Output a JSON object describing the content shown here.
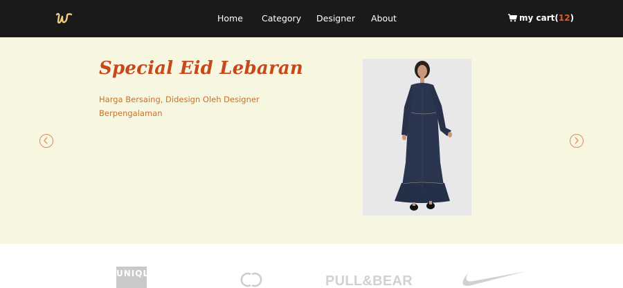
{
  "navbar": {
    "logo_icon": "w-script-logo-icon",
    "links": [
      "Home",
      "Category",
      "Designer",
      "About"
    ],
    "cart": {
      "icon": "shopping-cart-icon",
      "label": "my cart",
      "open": "(",
      "count": "12",
      "close": ")"
    }
  },
  "hero": {
    "title": "Special Eid Lebaran",
    "subtitle": "Harga Bersaing, Didesign Oleh Designer Berpengalaman",
    "prev_icon": "chevron-left-icon",
    "next_icon": "chevron-right-icon",
    "image": "denim-maxi-dress-model-photo"
  },
  "brands": {
    "uniqlo": "UNIQLO",
    "chanel_icon": "chanel-logo-icon",
    "pullbear": "PULL&BEAR",
    "nike_icon": "nike-swoosh-icon"
  },
  "colors": {
    "navbar_bg": "#1a1a1a",
    "hero_bg": "#f7f6e1",
    "accent": "#c8481a",
    "cart_count": "#e2572a"
  }
}
